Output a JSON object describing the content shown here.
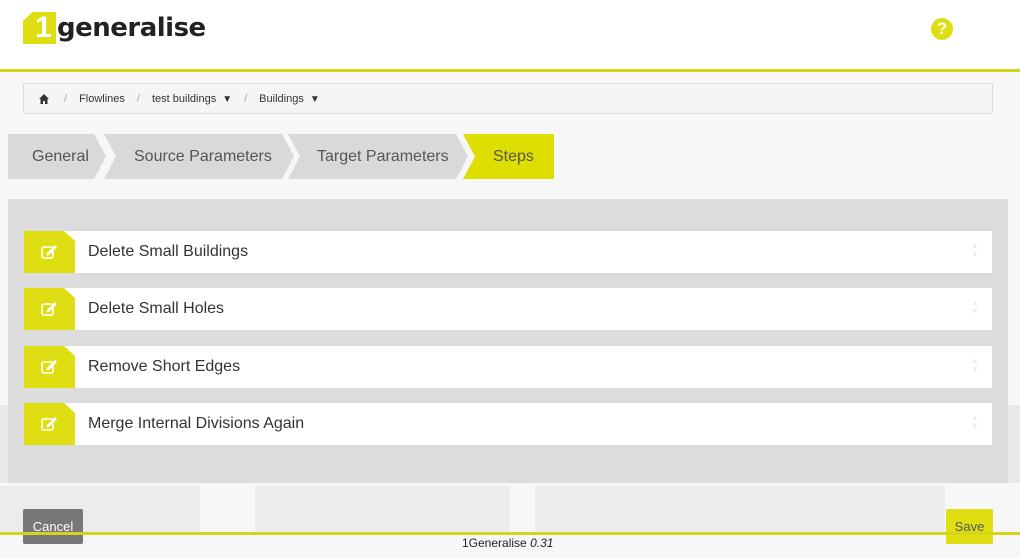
{
  "app": {
    "logo_digit": "1",
    "logo_text": "generalise",
    "help_icon": "question-circle-icon"
  },
  "breadcrumb": {
    "home_icon": "home-icon",
    "separator": "/",
    "items": [
      {
        "label": "Flowlines",
        "dropdown": false
      },
      {
        "label": "test buildings",
        "dropdown": true
      },
      {
        "label": "Buildings",
        "dropdown": true
      }
    ],
    "caret": "▼"
  },
  "wizard": {
    "tabs": [
      {
        "label": "General",
        "active": false
      },
      {
        "label": "Source Parameters",
        "active": false
      },
      {
        "label": "Target Parameters",
        "active": false
      },
      {
        "label": "Steps",
        "active": true
      }
    ]
  },
  "steps": [
    {
      "label": "Delete Small Buildings",
      "icon": "edit-icon"
    },
    {
      "label": "Delete Small Holes",
      "icon": "edit-icon"
    },
    {
      "label": "Remove Short Edges",
      "icon": "edit-icon"
    },
    {
      "label": "Merge Internal Divisions Again",
      "icon": "edit-icon"
    }
  ],
  "footer": {
    "cancel_label": "Cancel",
    "save_label": "Save",
    "product": "1Generalise",
    "version": "0.31"
  },
  "colors": {
    "accent": "#dede13",
    "accent_line": "#d4d41a",
    "panel": "#dcdcdc"
  }
}
